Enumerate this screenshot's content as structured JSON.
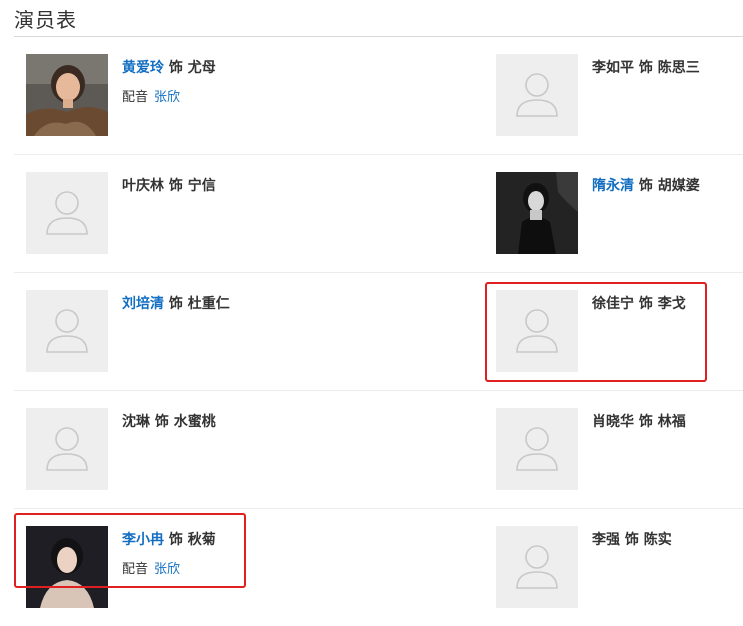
{
  "section": {
    "title": "演员表"
  },
  "cast": [
    {
      "actor": "黄爱玲",
      "link": true,
      "sep": "饰",
      "role": "尤母",
      "dub_label": "配音",
      "dub_name": "张欣",
      "photo": "portrait-elder-woman"
    },
    {
      "actor": "李如平",
      "link": false,
      "sep": "饰",
      "role": "陈思三",
      "photo": "placeholder"
    },
    {
      "actor": "叶庆林",
      "link": false,
      "sep": "饰",
      "role": "宁信",
      "photo": "placeholder"
    },
    {
      "actor": "隋永清",
      "link": true,
      "sep": "饰",
      "role": "胡媒婆",
      "photo": "portrait-bw-woman"
    },
    {
      "actor": "刘培清",
      "link": true,
      "sep": "饰",
      "role": "杜重仁",
      "photo": "placeholder"
    },
    {
      "actor": "徐佳宁",
      "link": false,
      "sep": "饰",
      "role": "李戈",
      "photo": "placeholder"
    },
    {
      "actor": "沈琳",
      "link": false,
      "sep": "饰",
      "role": "水蜜桃",
      "photo": "placeholder"
    },
    {
      "actor": "肖晓华",
      "link": false,
      "sep": "饰",
      "role": "林福",
      "photo": "placeholder"
    },
    {
      "actor": "李小冉",
      "link": true,
      "sep": "饰",
      "role": "秋菊",
      "dub_label": "配音",
      "dub_name": "张欣",
      "photo": "portrait-young-woman"
    },
    {
      "actor": "李强",
      "link": false,
      "sep": "饰",
      "role": "陈实",
      "photo": "placeholder"
    }
  ],
  "colors": {
    "link": "#136ec2",
    "highlight": "#e02020",
    "placeholder_bg": "#eeeeee",
    "placeholder_icon": "#c8c8c8"
  }
}
